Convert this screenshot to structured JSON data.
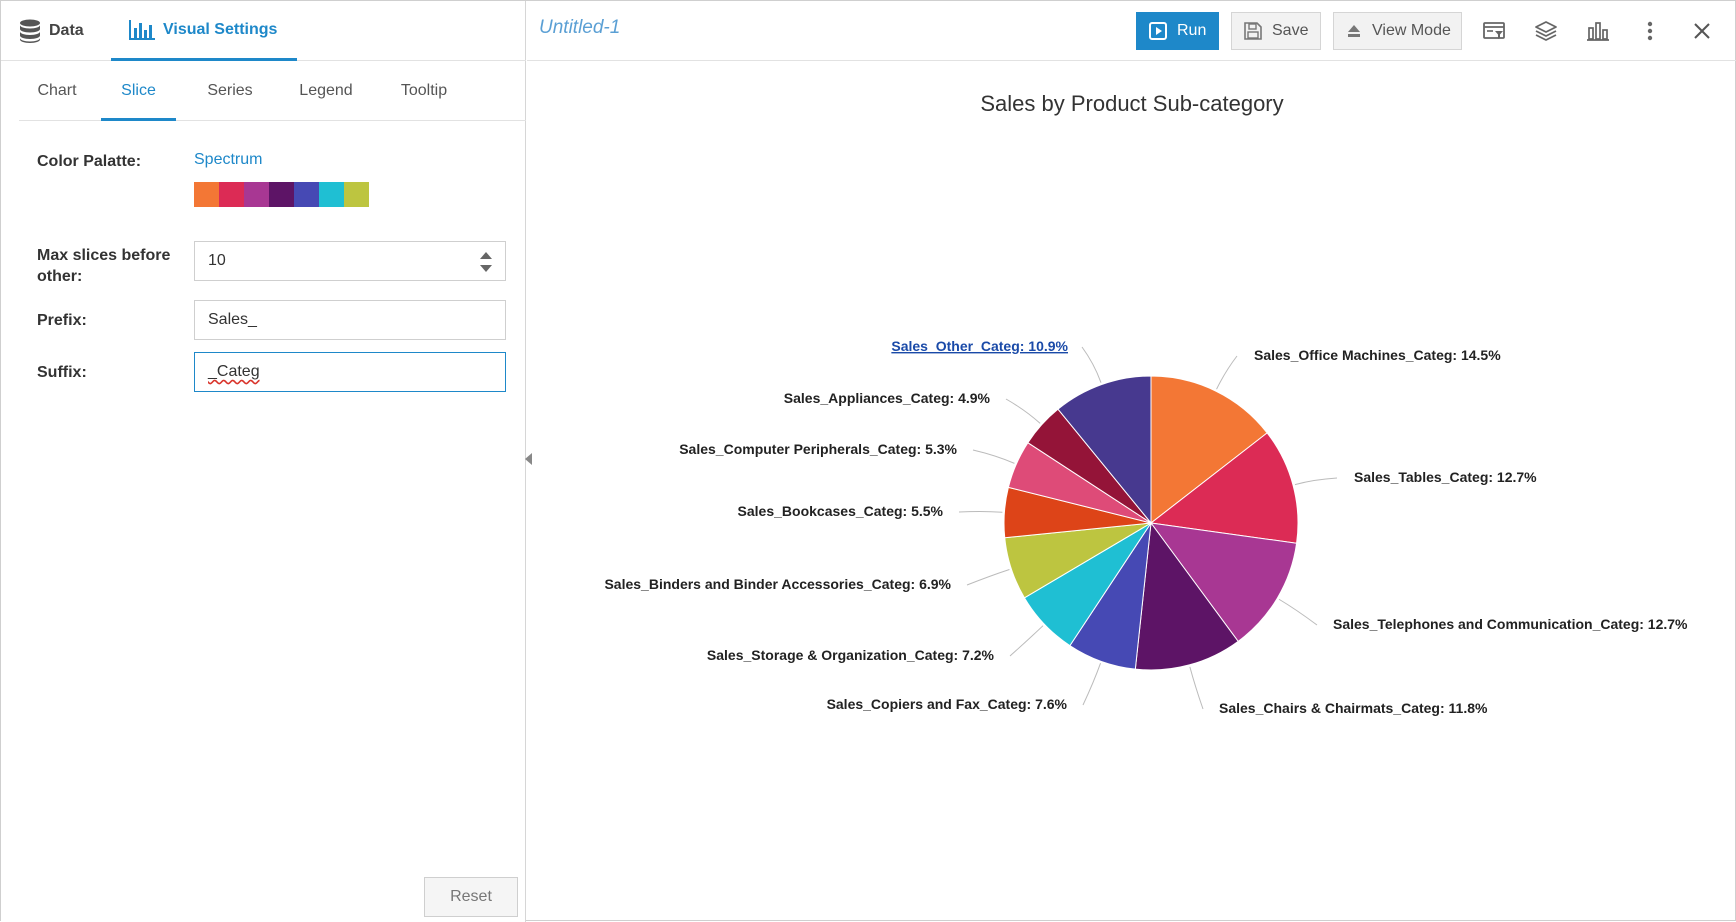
{
  "left_panel": {
    "top_tabs": {
      "data": "Data",
      "visual": "Visual Settings"
    },
    "sub_tabs": [
      "Chart",
      "Slice",
      "Series",
      "Legend",
      "Tooltip"
    ],
    "active_sub_tab": "Slice",
    "color_palette": {
      "label": "Color Palatte:",
      "name": "Spectrum",
      "swatches": [
        "#f37735",
        "#dc2b55",
        "#a83793",
        "#5d1466",
        "#4649b4",
        "#1fbfd3",
        "#bdc540"
      ]
    },
    "max_slices": {
      "label_line1": "Max slices before",
      "label_line2": "other:",
      "value": "10"
    },
    "prefix": {
      "label": "Prefix:",
      "value": "Sales_"
    },
    "suffix": {
      "label": "Suffix:",
      "value": "_Categ"
    },
    "reset": "Reset"
  },
  "header": {
    "title": "Untitled-1",
    "run": "Run",
    "save": "Save",
    "view_mode": "View Mode"
  },
  "chart_data": {
    "type": "pie",
    "title": "Sales by Product Sub-category",
    "slices": [
      {
        "label": "Sales_Office Machines_Categ: 14.5%",
        "value": 14.5,
        "color": "#f37735"
      },
      {
        "label": "Sales_Tables_Categ: 12.7%",
        "value": 12.7,
        "color": "#dc2b55"
      },
      {
        "label": "Sales_Telephones and Communication_Categ: 12.7%",
        "value": 12.7,
        "color": "#a83793"
      },
      {
        "label": "Sales_Chairs & Chairmats_Categ: 11.8%",
        "value": 11.8,
        "color": "#5d1466"
      },
      {
        "label": "Sales_Copiers and Fax_Categ: 7.6%",
        "value": 7.6,
        "color": "#4649b4"
      },
      {
        "label": "Sales_Storage & Organization_Categ: 7.2%",
        "value": 7.2,
        "color": "#1fbfd3"
      },
      {
        "label": "Sales_Binders and Binder Accessories_Categ: 6.9%",
        "value": 6.9,
        "color": "#bdc540"
      },
      {
        "label": "Sales_Bookcases_Categ: 5.5%",
        "value": 5.5,
        "color": "#dd4418"
      },
      {
        "label": "Sales_Computer Peripherals_Categ: 5.3%",
        "value": 5.3,
        "color": "#de4b78"
      },
      {
        "label": "Sales_Appliances_Categ: 4.9%",
        "value": 4.9,
        "color": "#941438"
      },
      {
        "label": "Sales_Other_Categ: 10.9%",
        "value": 10.9,
        "color": "#47398f"
      }
    ]
  }
}
